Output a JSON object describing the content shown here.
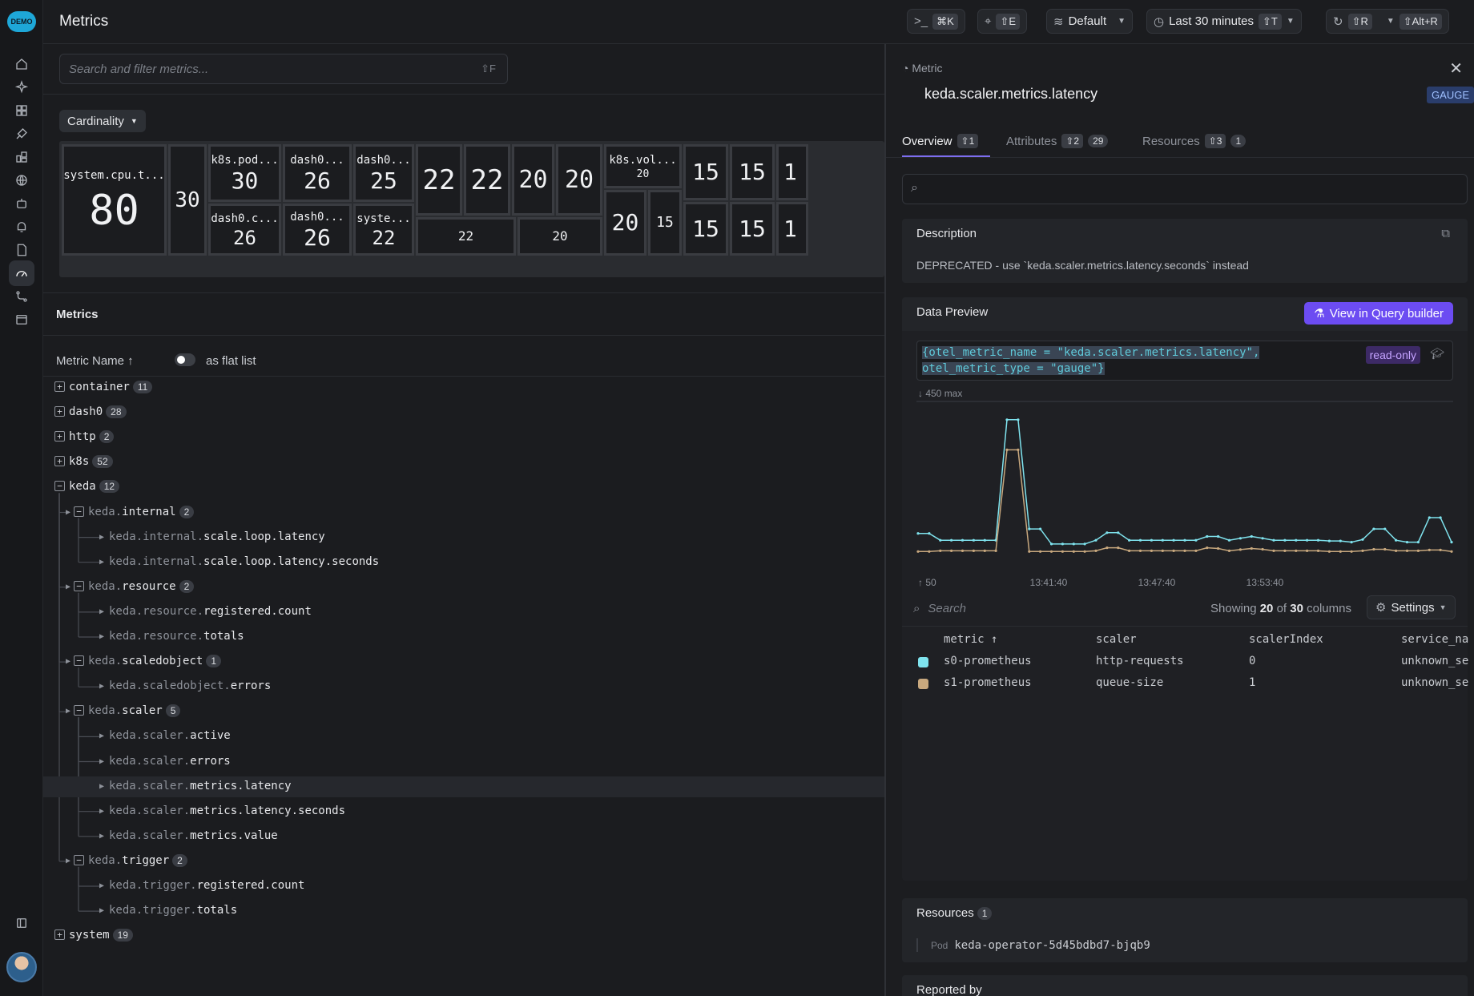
{
  "app": {
    "logo_text": "DEMO"
  },
  "header": {
    "title": "Metrics",
    "command_shortcut": "⌘K",
    "share_shortcut": "⇧E",
    "dataset_label": "Default",
    "time_range_label": "Last 30 minutes",
    "time_range_shortcut": "⇧T",
    "refresh_shortcut": "⇧R",
    "auto_refresh_shortcut": "⇧Alt+R"
  },
  "search": {
    "placeholder": "Search and filter metrics...",
    "shortcut": "⇧F"
  },
  "cardinality": {
    "selector_label": "Cardinality",
    "cells": [
      {
        "title": "system.cpu.t...",
        "value": "80"
      },
      {
        "title": "",
        "value": "30"
      },
      {
        "title": "k8s.pod...",
        "value": "30"
      },
      {
        "title": "dash0.c...",
        "value": "26"
      },
      {
        "title": "dash0...",
        "value": "26"
      },
      {
        "title": "dash0...",
        "value": "26"
      },
      {
        "title": "dash0...",
        "value": "25"
      },
      {
        "title": "syste...",
        "value": "22"
      },
      {
        "title": "",
        "value": "22"
      },
      {
        "title": "",
        "value": "22"
      },
      {
        "title": "",
        "value": "22"
      },
      {
        "title": "",
        "value": "20"
      },
      {
        "title": "",
        "value": "20"
      },
      {
        "title": "",
        "value": "20"
      },
      {
        "title": "k8s.vol...",
        "value": "20"
      },
      {
        "title": "",
        "value": "20"
      },
      {
        "title": "",
        "value": "15"
      },
      {
        "title": "",
        "value": "15"
      },
      {
        "title": "",
        "value": "15"
      },
      {
        "title": "",
        "value": "15"
      },
      {
        "title": "",
        "value": "15"
      },
      {
        "title": "",
        "value": "1"
      },
      {
        "title": "",
        "value": "1"
      }
    ]
  },
  "metrics_section": {
    "title": "Metrics",
    "column_label": "Metric Name ↑",
    "flat_list_label": "as flat list",
    "tree": [
      {
        "prefix": "",
        "name": "container",
        "count": "11",
        "type": "group-collapsed"
      },
      {
        "prefix": "",
        "name": "dash0",
        "count": "28",
        "type": "group-collapsed"
      },
      {
        "prefix": "",
        "name": "http",
        "count": "2",
        "type": "group-collapsed"
      },
      {
        "prefix": "",
        "name": "k8s",
        "count": "52",
        "type": "group-collapsed"
      },
      {
        "prefix": "",
        "name": "keda",
        "count": "12",
        "type": "group-expanded"
      },
      {
        "prefix": "keda.",
        "name": "internal",
        "count": "2",
        "type": "subgroup"
      },
      {
        "prefix": "keda.internal.",
        "name": "scale.loop.latency",
        "count": "",
        "type": "leaf"
      },
      {
        "prefix": "keda.internal.",
        "name": "scale.loop.latency.seconds",
        "count": "",
        "type": "leaf"
      },
      {
        "prefix": "keda.",
        "name": "resource",
        "count": "2",
        "type": "subgroup"
      },
      {
        "prefix": "keda.resource.",
        "name": "registered.count",
        "count": "",
        "type": "leaf"
      },
      {
        "prefix": "keda.resource.",
        "name": "totals",
        "count": "",
        "type": "leaf"
      },
      {
        "prefix": "keda.",
        "name": "scaledobject",
        "count": "1",
        "type": "subgroup"
      },
      {
        "prefix": "keda.scaledobject.",
        "name": "errors",
        "count": "",
        "type": "leaf"
      },
      {
        "prefix": "keda.",
        "name": "scaler",
        "count": "5",
        "type": "subgroup"
      },
      {
        "prefix": "keda.scaler.",
        "name": "active",
        "count": "",
        "type": "leaf"
      },
      {
        "prefix": "keda.scaler.",
        "name": "errors",
        "count": "",
        "type": "leaf"
      },
      {
        "prefix": "keda.scaler.",
        "name": "metrics.latency",
        "count": "",
        "type": "leaf",
        "selected": true
      },
      {
        "prefix": "keda.scaler.",
        "name": "metrics.latency.seconds",
        "count": "",
        "type": "leaf"
      },
      {
        "prefix": "keda.scaler.",
        "name": "metrics.value",
        "count": "",
        "type": "leaf"
      },
      {
        "prefix": "keda.",
        "name": "trigger",
        "count": "2",
        "type": "subgroup"
      },
      {
        "prefix": "keda.trigger.",
        "name": "registered.count",
        "count": "",
        "type": "leaf"
      },
      {
        "prefix": "keda.trigger.",
        "name": "totals",
        "count": "",
        "type": "leaf"
      },
      {
        "prefix": "",
        "name": "system",
        "count": "19",
        "type": "group-collapsed"
      }
    ]
  },
  "panel": {
    "kind_label": "Metric",
    "metric_name": "keda.scaler.metrics.latency",
    "type_badge": "GAUGE",
    "tabs": [
      {
        "label": "Overview",
        "shortcut": "⇧1",
        "count": ""
      },
      {
        "label": "Attributes",
        "shortcut": "⇧2",
        "count": "29"
      },
      {
        "label": "Resources",
        "shortcut": "⇧3",
        "count": "1"
      }
    ],
    "description_title": "Description",
    "description_text": "DEPRECATED - use `keda.scaler.metrics.latency.seconds` instead",
    "preview_title": "Data Preview",
    "query_builder_label": "View in Query builder",
    "query_line1": "{otel_metric_name = \"keda.scaler.metrics.latency\",",
    "query_line2": "otel_metric_type = \"gauge\"}",
    "read_only_label": "read-only",
    "table_search_placeholder": "Search",
    "showing_prefix": "Showing",
    "showing_count": "20",
    "showing_mid": "of",
    "showing_total": "30",
    "showing_suffix": "columns",
    "settings_label": "Settings",
    "columns": [
      "metric ↑",
      "scaler",
      "scalerIndex",
      "service_na"
    ],
    "rows": [
      {
        "metric": "s0-prometheus",
        "scaler": "http-requests",
        "scalerIndex": "0",
        "service": "unknown_se",
        "color": "#7fe3ee"
      },
      {
        "metric": "s1-prometheus",
        "scaler": "queue-size",
        "scalerIndex": "1",
        "service": "unknown_se",
        "color": "#c8a87e"
      }
    ],
    "resources_title": "Resources",
    "resources_count": "1",
    "resource_key": "Pod",
    "resource_value": "keda-operator-5d45bdbd7-bjqb9",
    "reported_by_title": "Reported by"
  },
  "chart_data": {
    "type": "line",
    "max_label": "↓ 450 max",
    "min_label": "↑ 50",
    "x_tick_labels": [
      "13:41:40",
      "13:47:40",
      "13:53:40"
    ],
    "ylim": [
      50,
      450
    ],
    "series": [
      {
        "name": "s0-prometheus",
        "color": "#7fe3ee",
        "values": [
          108,
          108,
          90,
          90,
          90,
          90,
          90,
          90,
          410,
          410,
          120,
          120,
          80,
          80,
          80,
          80,
          90,
          110,
          110,
          90,
          90,
          90,
          90,
          90,
          90,
          90,
          100,
          100,
          90,
          95,
          100,
          95,
          90,
          90,
          90,
          90,
          90,
          88,
          88,
          85,
          92,
          120,
          120,
          90,
          85,
          85,
          150,
          150,
          85
        ]
      },
      {
        "name": "s1-prometheus",
        "color": "#c8a87e",
        "values": [
          60,
          60,
          62,
          62,
          62,
          62,
          62,
          62,
          330,
          330,
          60,
          60,
          60,
          60,
          60,
          60,
          62,
          70,
          70,
          62,
          62,
          62,
          62,
          62,
          62,
          62,
          70,
          68,
          62,
          65,
          68,
          66,
          62,
          62,
          62,
          62,
          62,
          60,
          60,
          60,
          62,
          66,
          66,
          62,
          62,
          62,
          64,
          64,
          60
        ]
      }
    ]
  }
}
